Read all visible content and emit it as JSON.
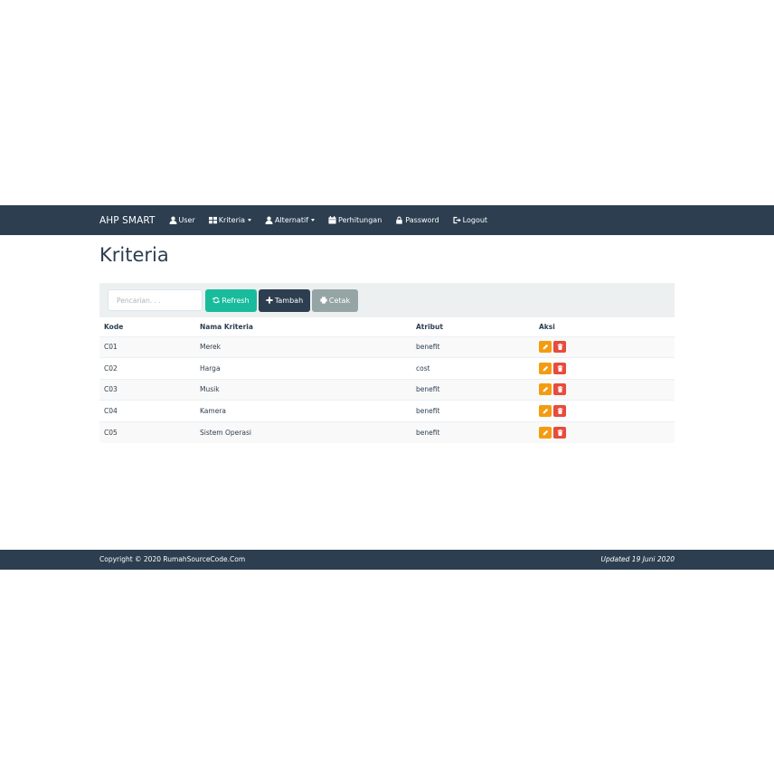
{
  "navbar": {
    "brand": "AHP SMART",
    "items": [
      {
        "label": "User",
        "icon": "user-icon",
        "dropdown": false
      },
      {
        "label": "Kriteria",
        "icon": "grid-icon",
        "dropdown": true
      },
      {
        "label": "Alternatif",
        "icon": "user-icon",
        "dropdown": true
      },
      {
        "label": "Perhitungan",
        "icon": "calendar-icon",
        "dropdown": false
      },
      {
        "label": "Password",
        "icon": "lock-icon",
        "dropdown": false
      },
      {
        "label": "Logout",
        "icon": "logout-icon",
        "dropdown": false
      }
    ]
  },
  "page": {
    "title": "Kriteria"
  },
  "toolbar": {
    "search_placeholder": "Pencarian. . .",
    "search_value": "",
    "refresh_label": "Refresh",
    "tambah_label": "Tambah",
    "cetak_label": "Cetak"
  },
  "table": {
    "headers": [
      "Kode",
      "Nama Kriteria",
      "Atribut",
      "Aksi"
    ],
    "rows": [
      {
        "kode": "C01",
        "nama": "Merek",
        "atribut": "benefit"
      },
      {
        "kode": "C02",
        "nama": "Harga",
        "atribut": "cost"
      },
      {
        "kode": "C03",
        "nama": "Musik",
        "atribut": "benefit"
      },
      {
        "kode": "C04",
        "nama": "Kamera",
        "atribut": "benefit"
      },
      {
        "kode": "C05",
        "nama": "Sistem Operasi",
        "atribut": "benefit"
      }
    ]
  },
  "footer": {
    "copyright": "Copyright © 2020 RumahSourceCode.Com",
    "updated": "Updated 19 Juni 2020"
  },
  "colors": {
    "primary": "#2c3e50",
    "success": "#18bc9c",
    "default": "#95a5a6",
    "warning": "#f39c12",
    "danger": "#e74c3c",
    "light": "#ecf0f1"
  }
}
